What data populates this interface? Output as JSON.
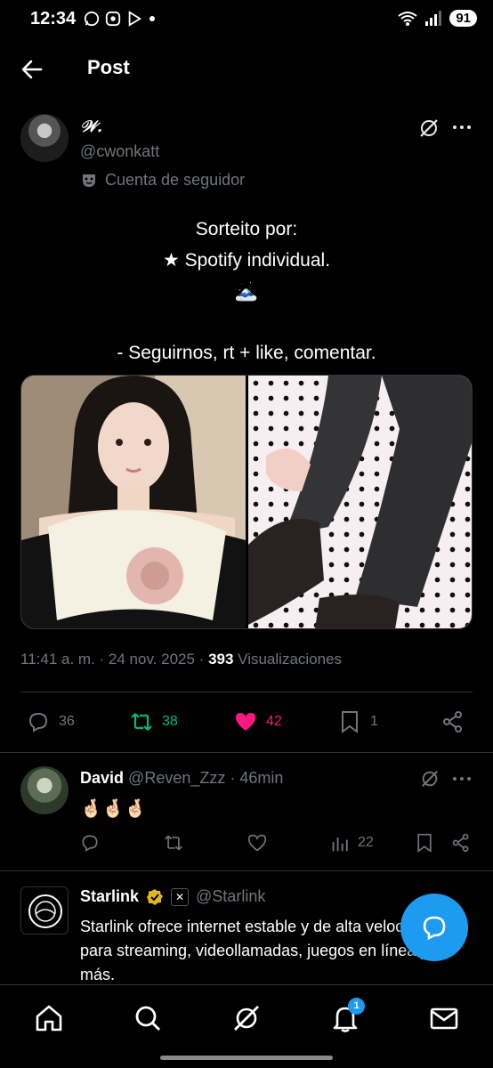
{
  "status_bar": {
    "time": "12:34",
    "battery": "91"
  },
  "header": {
    "title": "Post"
  },
  "post": {
    "author_name": "𝒲.",
    "author_handle": "@cwonkatt",
    "follower_label": "Cuenta de seguidor",
    "text_lines": [
      "Sorteito por:",
      "★ Spotify individual.",
      "🗻",
      "- Seguirnos, rt + like, comentar."
    ],
    "time": "11:41 a. m.",
    "date": "24 nov. 2025",
    "views_count": "393",
    "views_label": "Visualizaciones",
    "replies": "36",
    "reposts": "38",
    "likes": "42",
    "bookmarks": "1"
  },
  "reply": {
    "name": "David",
    "handle": "@Reven_Zzz",
    "age": "46min",
    "text": "🤞🏻🤞🏻🤞🏻",
    "views": "22"
  },
  "ad": {
    "name": "Starlink",
    "handle": "@Starlink",
    "text": "Starlink ofrece internet estable y de alta velocidad para streaming, videollamadas, juegos en línea y más."
  },
  "nav": {
    "notifications_count": "1"
  },
  "colors": {
    "accent": "#1d9bf0",
    "repost": "#00ba7c",
    "like": "#f91880",
    "muted": "#71767b"
  }
}
